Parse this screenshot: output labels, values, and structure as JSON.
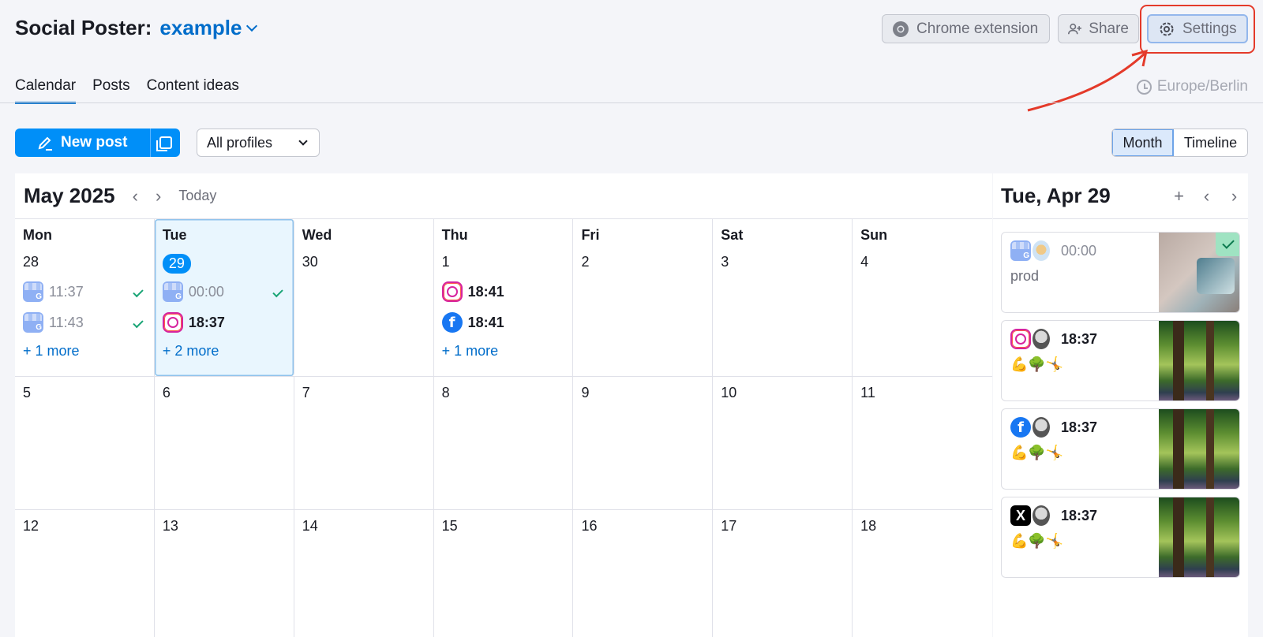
{
  "header": {
    "app_title": "Social Poster:",
    "project": "example",
    "chrome_extension": "Chrome extension",
    "share": "Share",
    "settings": "Settings"
  },
  "tabs": [
    {
      "label": "Calendar",
      "active": true
    },
    {
      "label": "Posts",
      "active": false
    },
    {
      "label": "Content ideas",
      "active": false
    }
  ],
  "timezone": "Europe/Berlin",
  "toolbar": {
    "new_post": "New post",
    "profiles_select": "All profiles",
    "view_month": "Month",
    "view_timeline": "Timeline"
  },
  "calendar": {
    "month_label": "May 2025",
    "today": "Today",
    "weekdays": [
      "Mon",
      "Tue",
      "Wed",
      "Thu",
      "Fri",
      "Sat",
      "Sun"
    ],
    "week1": [
      {
        "day": "28",
        "posts": [
          {
            "icon": "google-business-icon",
            "time": "11:37",
            "published": true
          },
          {
            "icon": "google-business-icon",
            "time": "11:43",
            "published": true
          }
        ],
        "more": "+ 1 more"
      },
      {
        "day": "29",
        "selected": true,
        "posts": [
          {
            "icon": "google-business-icon",
            "time": "00:00",
            "published": true
          },
          {
            "icon": "instagram-icon",
            "time": "18:37",
            "published": false
          }
        ],
        "more": "+ 2 more"
      },
      {
        "day": "30",
        "posts": []
      },
      {
        "day": "1",
        "posts": [
          {
            "icon": "instagram-icon",
            "time": "18:41",
            "published": false
          },
          {
            "icon": "facebook-icon",
            "time": "18:41",
            "published": false
          }
        ],
        "more": "+ 1 more"
      },
      {
        "day": "2",
        "posts": []
      },
      {
        "day": "3",
        "posts": []
      },
      {
        "day": "4",
        "posts": []
      }
    ],
    "week2": [
      "5",
      "6",
      "7",
      "8",
      "9",
      "10",
      "11"
    ],
    "week3": [
      "12",
      "13",
      "14",
      "15",
      "16",
      "17",
      "18"
    ]
  },
  "day_panel": {
    "title": "Tue, Apr 29",
    "cards": [
      {
        "network_icon": "google-business-icon",
        "time": "00:00",
        "text": "prod",
        "published": true
      },
      {
        "network_icon": "instagram-icon",
        "time": "18:37",
        "text": "💪🌳🤸"
      },
      {
        "network_icon": "facebook-icon",
        "time": "18:37",
        "text": "💪🌳🤸"
      },
      {
        "network_icon": "x-icon",
        "time": "18:37",
        "text": "💪🌳🤸"
      }
    ]
  },
  "colors": {
    "accent": "#008ff8",
    "link": "#006dca",
    "highlight": "#e43a2a",
    "success": "#1aa576"
  }
}
